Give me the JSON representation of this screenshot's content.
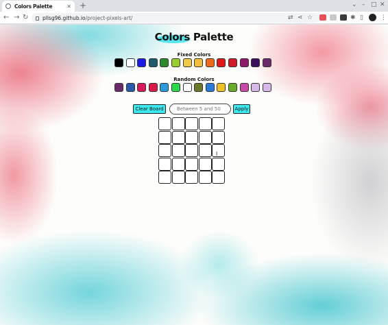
{
  "browser": {
    "tab_title": "Colors Palette",
    "url_host": "pllsg96.github.io",
    "url_path": "/project-pixels-art/",
    "new_tab_symbol": "+",
    "tab_close_symbol": "✕"
  },
  "page": {
    "title": "Colors Palette",
    "fixed_label": "Fixed Colors",
    "random_label": "Random Colors",
    "clear_label": "Clear Board",
    "input_placeholder": "Between 5 and 50",
    "apply_label": "Apply"
  },
  "fixed_colors": [
    "#000000",
    "#ffffff",
    "#1a1ae6",
    "#1e5a6b",
    "#2d8a2d",
    "#9acd32",
    "#f0c84a",
    "#f0be3c",
    "#f06a1e",
    "#e01818",
    "#d01a2a",
    "#8e1a6a",
    "#3a0f5c",
    "#6a2a6a"
  ],
  "random_colors": [
    "#6a2a6a",
    "#2a5aa8",
    "#d81a5a",
    "#d81a4a",
    "#2a9ad8",
    "#2ad84a",
    "#ffffff",
    "#6a7a2a",
    "#2a7ad8",
    "#f0c02a",
    "#6aaa2a",
    "#c84aa8",
    "#d8b8e8",
    "#d8b8e8"
  ],
  "board": {
    "rows": 5,
    "cols": 5
  }
}
